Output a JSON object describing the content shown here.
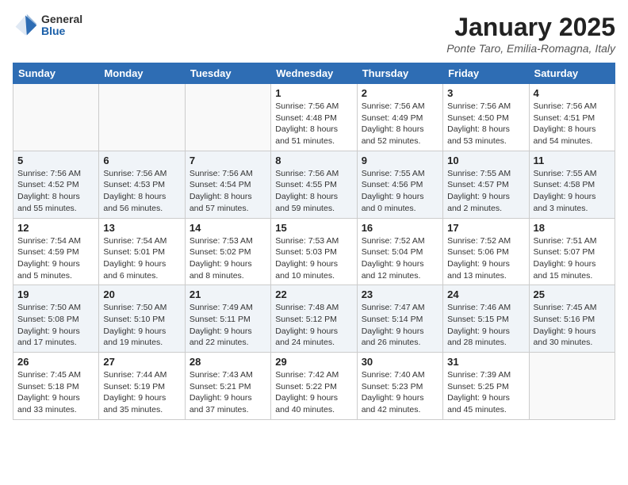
{
  "header": {
    "logo_general": "General",
    "logo_blue": "Blue",
    "month_title": "January 2025",
    "location": "Ponte Taro, Emilia-Romagna, Italy"
  },
  "weekdays": [
    "Sunday",
    "Monday",
    "Tuesday",
    "Wednesday",
    "Thursday",
    "Friday",
    "Saturday"
  ],
  "weeks": [
    [
      {
        "day": "",
        "sunrise": "",
        "sunset": "",
        "daylight": ""
      },
      {
        "day": "",
        "sunrise": "",
        "sunset": "",
        "daylight": ""
      },
      {
        "day": "",
        "sunrise": "",
        "sunset": "",
        "daylight": ""
      },
      {
        "day": "1",
        "sunrise": "Sunrise: 7:56 AM",
        "sunset": "Sunset: 4:48 PM",
        "daylight": "Daylight: 8 hours and 51 minutes."
      },
      {
        "day": "2",
        "sunrise": "Sunrise: 7:56 AM",
        "sunset": "Sunset: 4:49 PM",
        "daylight": "Daylight: 8 hours and 52 minutes."
      },
      {
        "day": "3",
        "sunrise": "Sunrise: 7:56 AM",
        "sunset": "Sunset: 4:50 PM",
        "daylight": "Daylight: 8 hours and 53 minutes."
      },
      {
        "day": "4",
        "sunrise": "Sunrise: 7:56 AM",
        "sunset": "Sunset: 4:51 PM",
        "daylight": "Daylight: 8 hours and 54 minutes."
      }
    ],
    [
      {
        "day": "5",
        "sunrise": "Sunrise: 7:56 AM",
        "sunset": "Sunset: 4:52 PM",
        "daylight": "Daylight: 8 hours and 55 minutes."
      },
      {
        "day": "6",
        "sunrise": "Sunrise: 7:56 AM",
        "sunset": "Sunset: 4:53 PM",
        "daylight": "Daylight: 8 hours and 56 minutes."
      },
      {
        "day": "7",
        "sunrise": "Sunrise: 7:56 AM",
        "sunset": "Sunset: 4:54 PM",
        "daylight": "Daylight: 8 hours and 57 minutes."
      },
      {
        "day": "8",
        "sunrise": "Sunrise: 7:56 AM",
        "sunset": "Sunset: 4:55 PM",
        "daylight": "Daylight: 8 hours and 59 minutes."
      },
      {
        "day": "9",
        "sunrise": "Sunrise: 7:55 AM",
        "sunset": "Sunset: 4:56 PM",
        "daylight": "Daylight: 9 hours and 0 minutes."
      },
      {
        "day": "10",
        "sunrise": "Sunrise: 7:55 AM",
        "sunset": "Sunset: 4:57 PM",
        "daylight": "Daylight: 9 hours and 2 minutes."
      },
      {
        "day": "11",
        "sunrise": "Sunrise: 7:55 AM",
        "sunset": "Sunset: 4:58 PM",
        "daylight": "Daylight: 9 hours and 3 minutes."
      }
    ],
    [
      {
        "day": "12",
        "sunrise": "Sunrise: 7:54 AM",
        "sunset": "Sunset: 4:59 PM",
        "daylight": "Daylight: 9 hours and 5 minutes."
      },
      {
        "day": "13",
        "sunrise": "Sunrise: 7:54 AM",
        "sunset": "Sunset: 5:01 PM",
        "daylight": "Daylight: 9 hours and 6 minutes."
      },
      {
        "day": "14",
        "sunrise": "Sunrise: 7:53 AM",
        "sunset": "Sunset: 5:02 PM",
        "daylight": "Daylight: 9 hours and 8 minutes."
      },
      {
        "day": "15",
        "sunrise": "Sunrise: 7:53 AM",
        "sunset": "Sunset: 5:03 PM",
        "daylight": "Daylight: 9 hours and 10 minutes."
      },
      {
        "day": "16",
        "sunrise": "Sunrise: 7:52 AM",
        "sunset": "Sunset: 5:04 PM",
        "daylight": "Daylight: 9 hours and 12 minutes."
      },
      {
        "day": "17",
        "sunrise": "Sunrise: 7:52 AM",
        "sunset": "Sunset: 5:06 PM",
        "daylight": "Daylight: 9 hours and 13 minutes."
      },
      {
        "day": "18",
        "sunrise": "Sunrise: 7:51 AM",
        "sunset": "Sunset: 5:07 PM",
        "daylight": "Daylight: 9 hours and 15 minutes."
      }
    ],
    [
      {
        "day": "19",
        "sunrise": "Sunrise: 7:50 AM",
        "sunset": "Sunset: 5:08 PM",
        "daylight": "Daylight: 9 hours and 17 minutes."
      },
      {
        "day": "20",
        "sunrise": "Sunrise: 7:50 AM",
        "sunset": "Sunset: 5:10 PM",
        "daylight": "Daylight: 9 hours and 19 minutes."
      },
      {
        "day": "21",
        "sunrise": "Sunrise: 7:49 AM",
        "sunset": "Sunset: 5:11 PM",
        "daylight": "Daylight: 9 hours and 22 minutes."
      },
      {
        "day": "22",
        "sunrise": "Sunrise: 7:48 AM",
        "sunset": "Sunset: 5:12 PM",
        "daylight": "Daylight: 9 hours and 24 minutes."
      },
      {
        "day": "23",
        "sunrise": "Sunrise: 7:47 AM",
        "sunset": "Sunset: 5:14 PM",
        "daylight": "Daylight: 9 hours and 26 minutes."
      },
      {
        "day": "24",
        "sunrise": "Sunrise: 7:46 AM",
        "sunset": "Sunset: 5:15 PM",
        "daylight": "Daylight: 9 hours and 28 minutes."
      },
      {
        "day": "25",
        "sunrise": "Sunrise: 7:45 AM",
        "sunset": "Sunset: 5:16 PM",
        "daylight": "Daylight: 9 hours and 30 minutes."
      }
    ],
    [
      {
        "day": "26",
        "sunrise": "Sunrise: 7:45 AM",
        "sunset": "Sunset: 5:18 PM",
        "daylight": "Daylight: 9 hours and 33 minutes."
      },
      {
        "day": "27",
        "sunrise": "Sunrise: 7:44 AM",
        "sunset": "Sunset: 5:19 PM",
        "daylight": "Daylight: 9 hours and 35 minutes."
      },
      {
        "day": "28",
        "sunrise": "Sunrise: 7:43 AM",
        "sunset": "Sunset: 5:21 PM",
        "daylight": "Daylight: 9 hours and 37 minutes."
      },
      {
        "day": "29",
        "sunrise": "Sunrise: 7:42 AM",
        "sunset": "Sunset: 5:22 PM",
        "daylight": "Daylight: 9 hours and 40 minutes."
      },
      {
        "day": "30",
        "sunrise": "Sunrise: 7:40 AM",
        "sunset": "Sunset: 5:23 PM",
        "daylight": "Daylight: 9 hours and 42 minutes."
      },
      {
        "day": "31",
        "sunrise": "Sunrise: 7:39 AM",
        "sunset": "Sunset: 5:25 PM",
        "daylight": "Daylight: 9 hours and 45 minutes."
      },
      {
        "day": "",
        "sunrise": "",
        "sunset": "",
        "daylight": ""
      }
    ]
  ]
}
